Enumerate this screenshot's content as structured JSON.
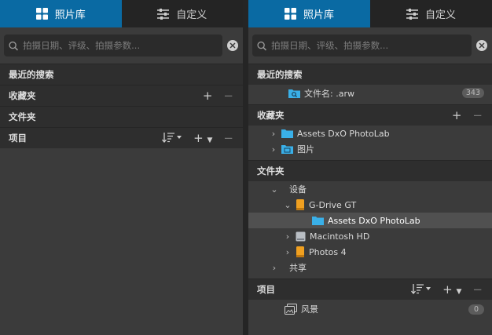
{
  "tabs": {
    "library": "照片库",
    "customize": "自定义"
  },
  "search": {
    "placeholder": "拍摄日期、评级、拍摄参数..."
  },
  "sections": {
    "recent_searches": "最近的搜索",
    "favorites": "收藏夹",
    "folders": "文件夹",
    "projects": "项目"
  },
  "right": {
    "recent_items": [
      {
        "label": "文件名: .arw",
        "count": "343"
      }
    ],
    "favorites_items": [
      {
        "label": "Assets DxO PhotoLab"
      },
      {
        "label": "图片"
      }
    ],
    "folders_tree": {
      "devices": "设备",
      "gdrive": "G-Drive GT",
      "assets": "Assets DxO PhotoLab",
      "macintosh": "Macintosh HD",
      "photos4": "Photos 4",
      "shared": "共享"
    },
    "projects_items": [
      {
        "label": "风景",
        "count": "0"
      }
    ]
  },
  "colors": {
    "accent": "#0a6aa3",
    "panel_bg": "#3b3b3b",
    "header_bg": "#2e2e2e",
    "folder_blue": "#3ab0e8",
    "drive_orange": "#f0a020"
  },
  "icons": [
    "grid-icon",
    "sliders-icon",
    "search-icon",
    "clear-icon",
    "plus-icon",
    "minus-icon",
    "sort-icon",
    "chevron-right-icon",
    "chevron-down-icon",
    "folder-icon",
    "drive-icon",
    "hard-drive-icon",
    "project-icon"
  ]
}
